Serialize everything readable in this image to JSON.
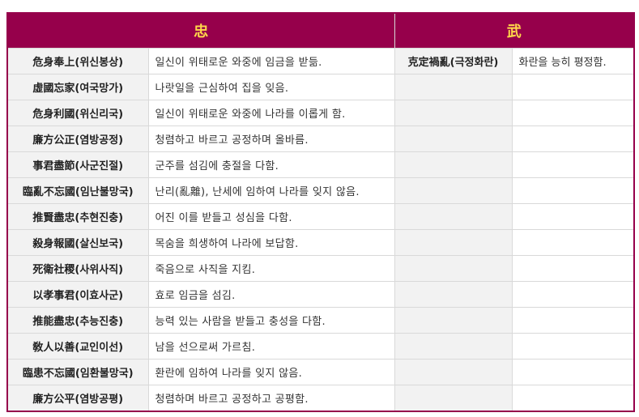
{
  "header": {
    "left": "忠",
    "right": "武"
  },
  "rows": [
    {
      "term": "危身奉上(위신봉상)",
      "def": "일신이 위태로운 와중에 임금을 받듦.",
      "term2": "克定禍亂(극정화란)",
      "def2": "화란을 능히 평정함."
    },
    {
      "term": "虛國忘家(여국망가)",
      "def": "나랏일을 근심하여 집을 잊음.",
      "term2": "",
      "def2": ""
    },
    {
      "term": "危身利國(위신리국)",
      "def": "일신이 위태로운 와중에 나라를 이롭게 함.",
      "term2": "",
      "def2": ""
    },
    {
      "term": "廉方公正(염방공정)",
      "def": "청렴하고 바르고 공정하며 올바름.",
      "term2": "",
      "def2": ""
    },
    {
      "term": "事君盡節(사군진절)",
      "def": "군주를 섬김에 충절을 다함.",
      "term2": "",
      "def2": ""
    },
    {
      "term": "臨亂不忘國(임난불망국)",
      "def": "난리(亂離), 난세에 임하여 나라를 잊지 않음.",
      "term2": "",
      "def2": ""
    },
    {
      "term": "推賢盡忠(추현진충)",
      "def": "어진 이를 받들고 성심을 다함.",
      "term2": "",
      "def2": ""
    },
    {
      "term": "殺身報國(살신보국)",
      "def": "목숨을 희생하여 나라에 보답함.",
      "term2": "",
      "def2": ""
    },
    {
      "term": "死衛社稷(사위사직)",
      "def": "죽음으로 사직을 지킴.",
      "term2": "",
      "def2": ""
    },
    {
      "term": "以孝事君(이효사군)",
      "def": "효로 임금을 섬김.",
      "term2": "",
      "def2": ""
    },
    {
      "term": "推能盡忠(추능진충)",
      "def": "능력 있는 사람을 받들고 충성을 다함.",
      "term2": "",
      "def2": ""
    },
    {
      "term": "敎人以善(교인이선)",
      "def": "남을 선으로써 가르침.",
      "term2": "",
      "def2": ""
    },
    {
      "term": "臨患不忘國(임환불망국)",
      "def": "환란에 임하여 나라를 잊지 않음.",
      "term2": "",
      "def2": ""
    },
    {
      "term": "廉方公平(염방공평)",
      "def": "청렴하며 바르고 공정하고 공평함.",
      "term2": "",
      "def2": ""
    }
  ]
}
